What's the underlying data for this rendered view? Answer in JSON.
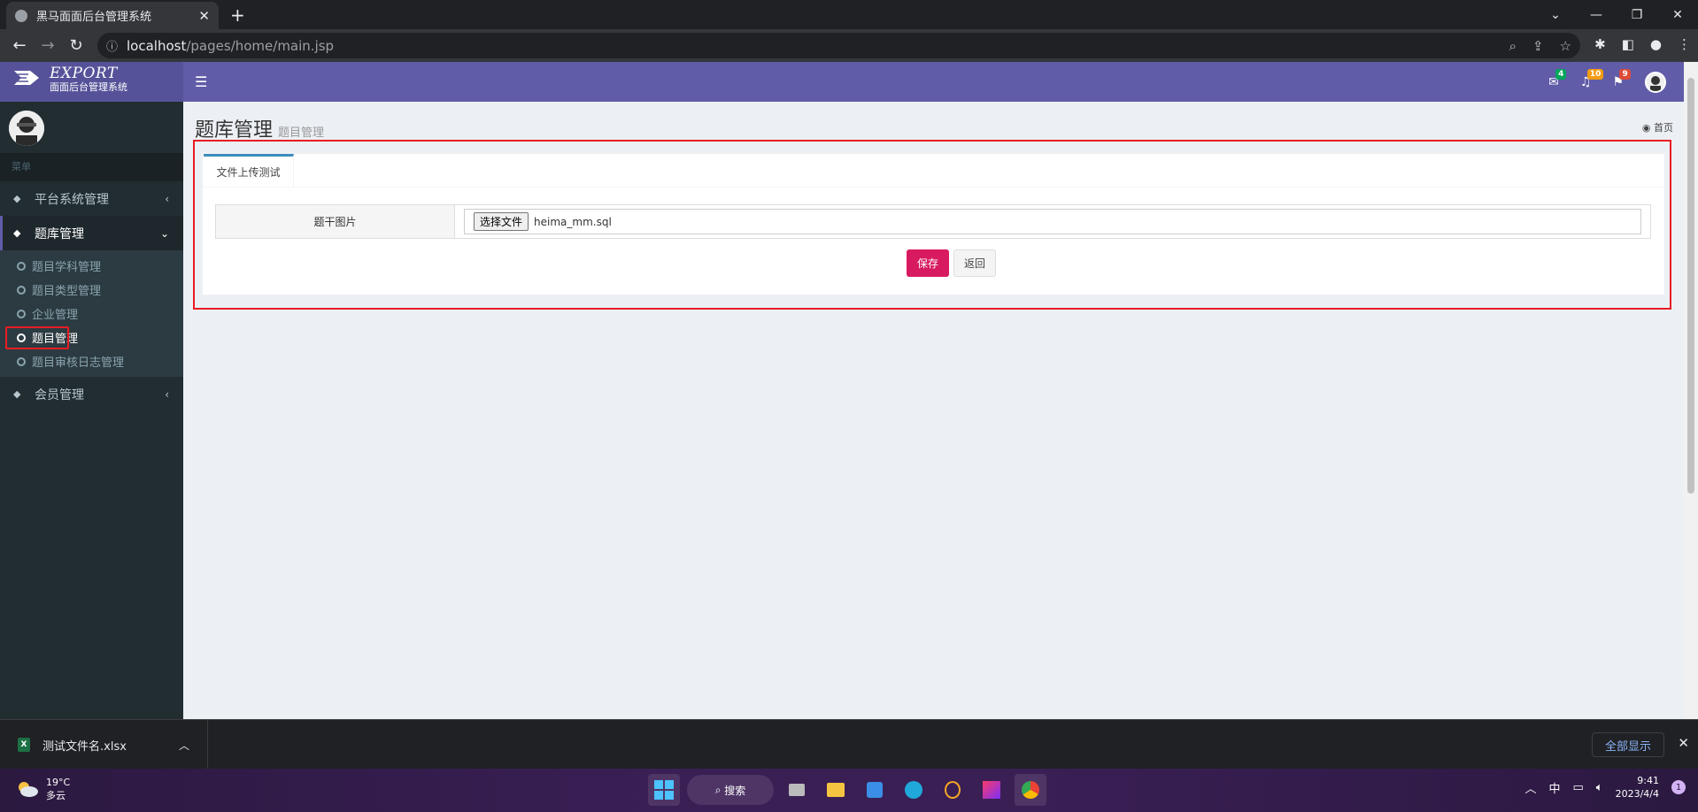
{
  "browser": {
    "tab_title": "黑马面面后台管理系统",
    "url_host": "localhost",
    "url_path": "/pages/home/main.jsp"
  },
  "app": {
    "logo_title": "EXPORT",
    "logo_subtitle": "面面后台管理系统",
    "badges": {
      "mail": "4",
      "bell": "10",
      "flag": "9"
    },
    "colors": {
      "header": "#605ca8",
      "logo_bg": "#555299",
      "sidebar": "#222d32",
      "save_button": "#d81b60",
      "highlight": "#e81c24"
    }
  },
  "sidebar": {
    "menu_header": "菜单",
    "items": [
      {
        "label": "平台系统管理",
        "arrow": "‹"
      },
      {
        "label": "题库管理",
        "arrow": "⌄"
      },
      {
        "label": "会员管理",
        "arrow": "‹"
      }
    ],
    "sub_items": [
      {
        "label": "题目学科管理"
      },
      {
        "label": "题目类型管理"
      },
      {
        "label": "企业管理"
      },
      {
        "label": "题目管理"
      },
      {
        "label": "题目审核日志管理"
      }
    ]
  },
  "content": {
    "title": "题库管理",
    "subtitle": "题目管理",
    "breadcrumb": "首页",
    "tab_label": "文件上传测试",
    "field_label": "题干图片",
    "file_button": "选择文件",
    "file_name": "heima_mm.sql",
    "save_label": "保存",
    "back_label": "返回"
  },
  "downloads": {
    "file_name": "测试文件名.xlsx",
    "show_all": "全部显示"
  },
  "taskbar": {
    "temperature": "19°C",
    "condition": "多云",
    "search": "搜索",
    "ime": "中",
    "time": "9:41",
    "date": "2023/4/4",
    "notifications": "1"
  }
}
